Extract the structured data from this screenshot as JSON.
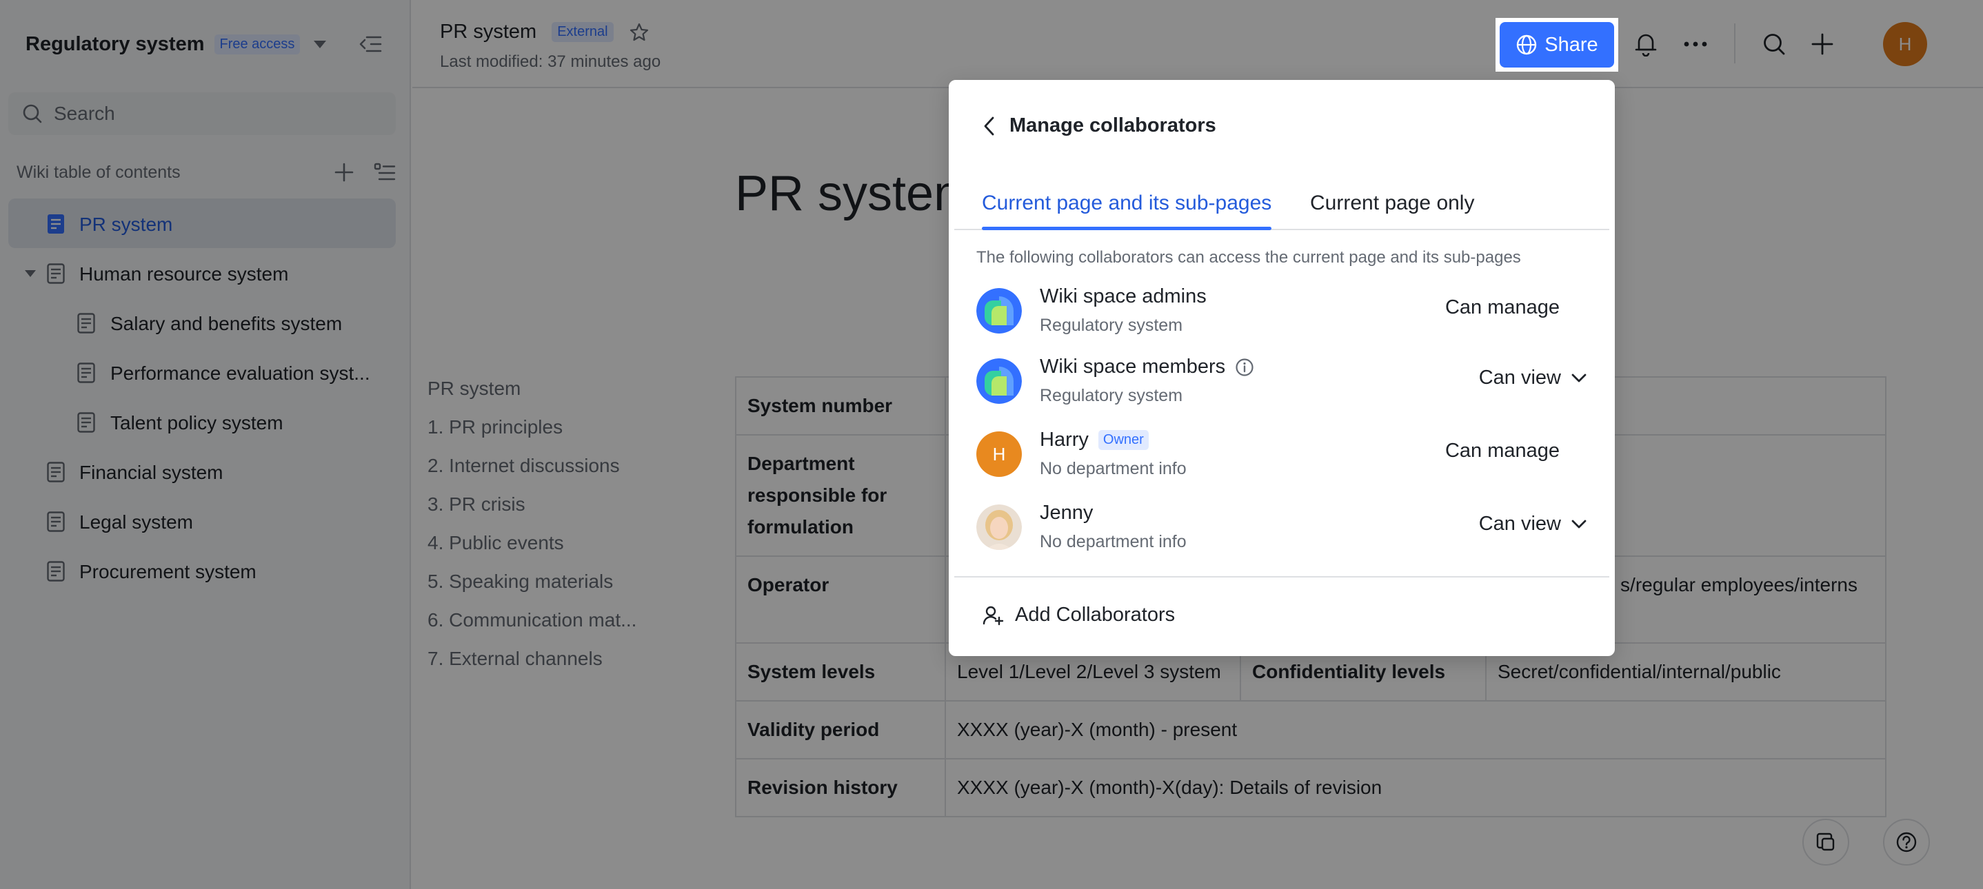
{
  "colors": {
    "accent": "#3370ff",
    "active_text": "#245bdb",
    "owner_avatar": "#e07a1c"
  },
  "sidebar": {
    "space_title": "Regulatory system",
    "space_badge": "Free access",
    "search_placeholder": "Search",
    "toc_label": "Wiki table of contents",
    "items": [
      {
        "label": "PR system",
        "level": 0,
        "active": true
      },
      {
        "label": "Human resource system",
        "level": 0,
        "expanded": true
      },
      {
        "label": "Salary and benefits system",
        "level": 1
      },
      {
        "label": "Performance evaluation syst...",
        "level": 1
      },
      {
        "label": "Talent policy system",
        "level": 1
      },
      {
        "label": "Financial system",
        "level": 0
      },
      {
        "label": "Legal system",
        "level": 0
      },
      {
        "label": "Procurement system",
        "level": 0
      }
    ]
  },
  "header": {
    "doc_title": "PR system",
    "doc_badge": "External",
    "last_modified": "Last modified: 37 minutes ago",
    "share_label": "Share",
    "avatar_initial": "H"
  },
  "main": {
    "heading": "PR system",
    "outline": [
      "PR system",
      "1. PR principles",
      "2. Internet discussions",
      "3. PR crisis",
      "4. Public events",
      "5. Speaking materials",
      "6. Communication mat...",
      "7. External channels"
    ],
    "table": {
      "system_number": "System number",
      "department": "Department responsible for formulation",
      "operator": "Operator",
      "operator_value_tail": "s/regular employees/interns",
      "system_levels": "System levels",
      "system_levels_value": "Level 1/Level 2/Level 3 system",
      "confidentiality": "Confidentiality levels",
      "confidentiality_value": "Secret/confidential/internal/public",
      "validity": "Validity period",
      "validity_value": "XXXX (year)-X (month) - present",
      "revision": "Revision history",
      "revision_value": "XXXX (year)-X (month)-X(day): Details of revision"
    }
  },
  "popup": {
    "title": "Manage collaborators",
    "tabs": [
      "Current page and its sub-pages",
      "Current page only"
    ],
    "description": "The following collaborators can access the current page and its sub-pages",
    "collaborators": [
      {
        "name": "Wiki space admins",
        "sub": "Regulatory system",
        "permission": "Can manage"
      },
      {
        "name": "Wiki space members",
        "sub": "Regulatory system",
        "permission": "Can view"
      },
      {
        "name": "Harry",
        "badge": "Owner",
        "sub": "No department info",
        "permission": "Can manage",
        "initial": "H"
      },
      {
        "name": "Jenny",
        "sub": "No department info",
        "permission": "Can view"
      }
    ],
    "add_label": "Add Collaborators"
  }
}
